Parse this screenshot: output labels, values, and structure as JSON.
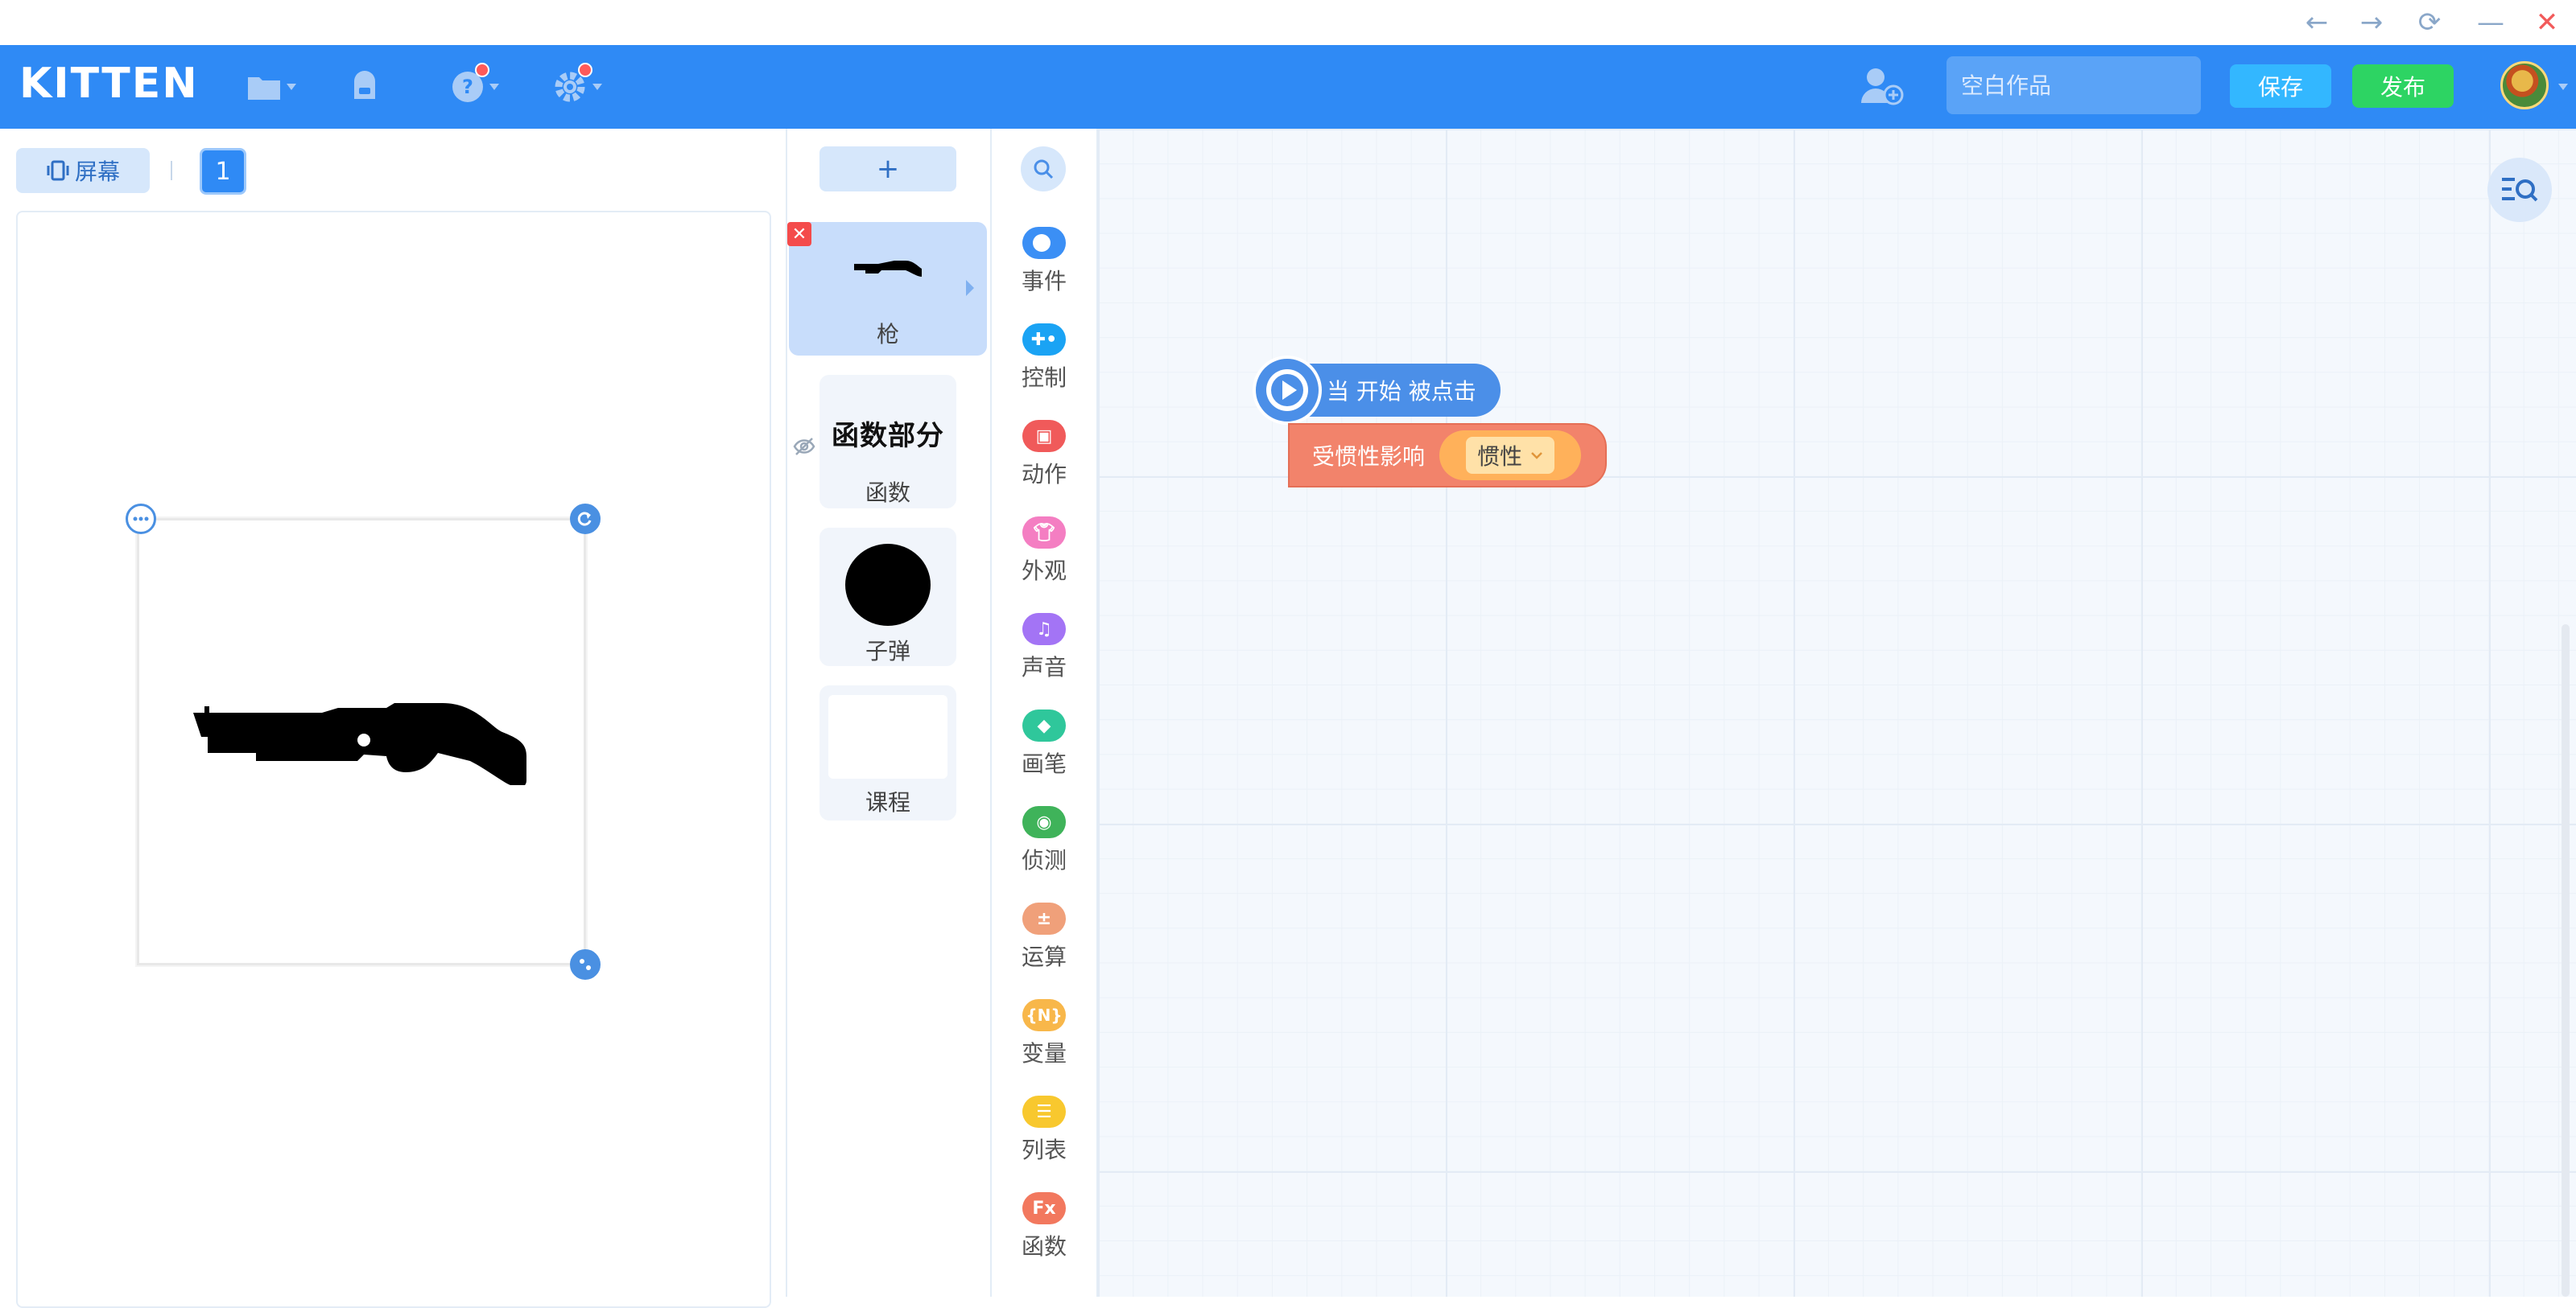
{
  "window": {
    "controls": [
      "←",
      "→",
      "⟳",
      "—",
      "✕"
    ]
  },
  "header": {
    "logo": "KITTEN",
    "search_placeholder": "空白作品",
    "save_label": "保存",
    "publish_label": "发布"
  },
  "stage": {
    "screen_label": "屏幕",
    "scene_number": "1"
  },
  "sprites": {
    "add_label": "+",
    "items": [
      {
        "name": "枪"
      },
      {
        "name": "函数",
        "thumb_text": "函数部分"
      },
      {
        "name": "子弹"
      },
      {
        "name": "课程"
      }
    ]
  },
  "categories": [
    {
      "label": "事件",
      "color": "#3b8ff5"
    },
    {
      "label": "控制",
      "color": "#1aa3f4"
    },
    {
      "label": "动作",
      "color": "#f05a5a"
    },
    {
      "label": "外观",
      "color": "#f47ec2"
    },
    {
      "label": "声音",
      "color": "#a374f5"
    },
    {
      "label": "画笔",
      "color": "#2fc79b"
    },
    {
      "label": "侦测",
      "color": "#3fb35a"
    },
    {
      "label": "运算",
      "color": "#f0a07a"
    },
    {
      "label": "变量",
      "color": "#f8b74a"
    },
    {
      "label": "列表",
      "color": "#f8c82e"
    },
    {
      "label": "函数",
      "color": "#f2785e"
    }
  ],
  "blocks": {
    "hat_text": "当 开始 被点击",
    "stack_text": "受惯性影响",
    "dropdown_value": "惯性"
  }
}
